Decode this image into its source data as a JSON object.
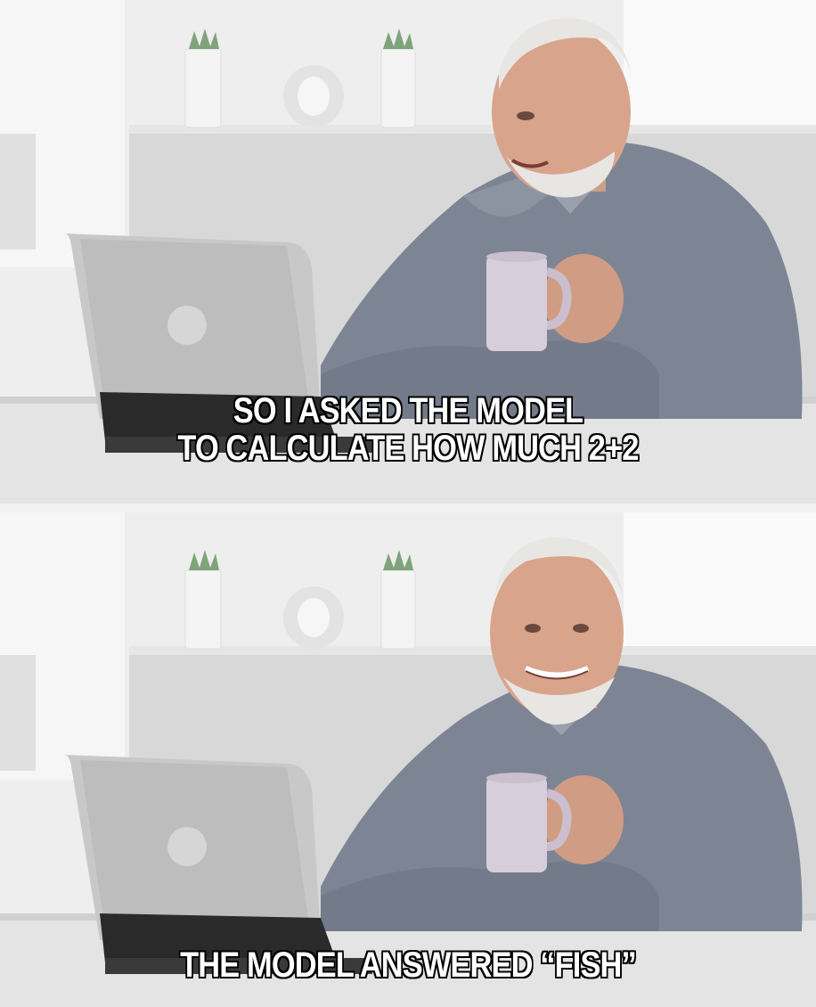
{
  "meme": {
    "top_caption": {
      "line1": "SO I ASKED THE MODEL",
      "line2": "TO CALCULATE HOW MUCH 2+2"
    },
    "bottom_caption": {
      "line1": "THE MODEL ANSWERED “FISH”"
    }
  },
  "colors": {
    "wall": "#eeeeee",
    "shelf": "#d7d7d7",
    "shirt": "#7d8594",
    "skin": "#d9a48c",
    "hair": "#e8e6e3",
    "mug": "#d8cedb",
    "laptop": "#c8c8c8",
    "laptop_dark": "#2a2a2a",
    "desk": "#e2e2e2"
  }
}
